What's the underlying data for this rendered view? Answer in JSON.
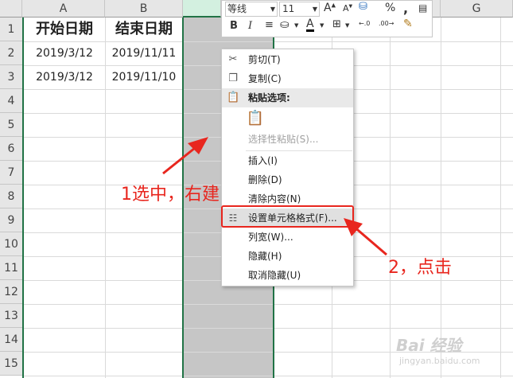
{
  "columns": [
    "A",
    "B",
    "",
    "",
    "",
    "",
    "G"
  ],
  "rows": [
    "1",
    "2",
    "3",
    "4",
    "5",
    "6",
    "7",
    "8",
    "9",
    "10",
    "11",
    "12",
    "13",
    "14",
    "15"
  ],
  "cells": {
    "a1": "开始日期",
    "b1": "结束日期",
    "a2": "2019/3/12",
    "b2": "2019/11/11",
    "a3": "2019/3/12",
    "b3": "2019/11/10"
  },
  "toolbar": {
    "font_name": "等线",
    "font_size": "11",
    "percent": "%",
    "comma": ","
  },
  "context_menu": {
    "cut": "剪切(T)",
    "copy": "复制(C)",
    "paste_options": "粘贴选项:",
    "paste_special": "选择性粘贴(S)...",
    "insert": "插入(I)",
    "delete": "删除(D)",
    "clear_contents": "清除内容(N)",
    "format_cells": "设置单元格格式(F)...",
    "column_width": "列宽(W)...",
    "hide": "隐藏(H)",
    "unhide": "取消隐藏(U)"
  },
  "annotations": {
    "step1": "1选中，右建",
    "step2": "2，点击"
  },
  "watermark": {
    "brand": "Bai 经验",
    "url": "jingyan.baidu.com"
  },
  "colors": {
    "accent": "#217346",
    "annotation": "#e8261e",
    "selected_column": "#c6c6c6"
  }
}
